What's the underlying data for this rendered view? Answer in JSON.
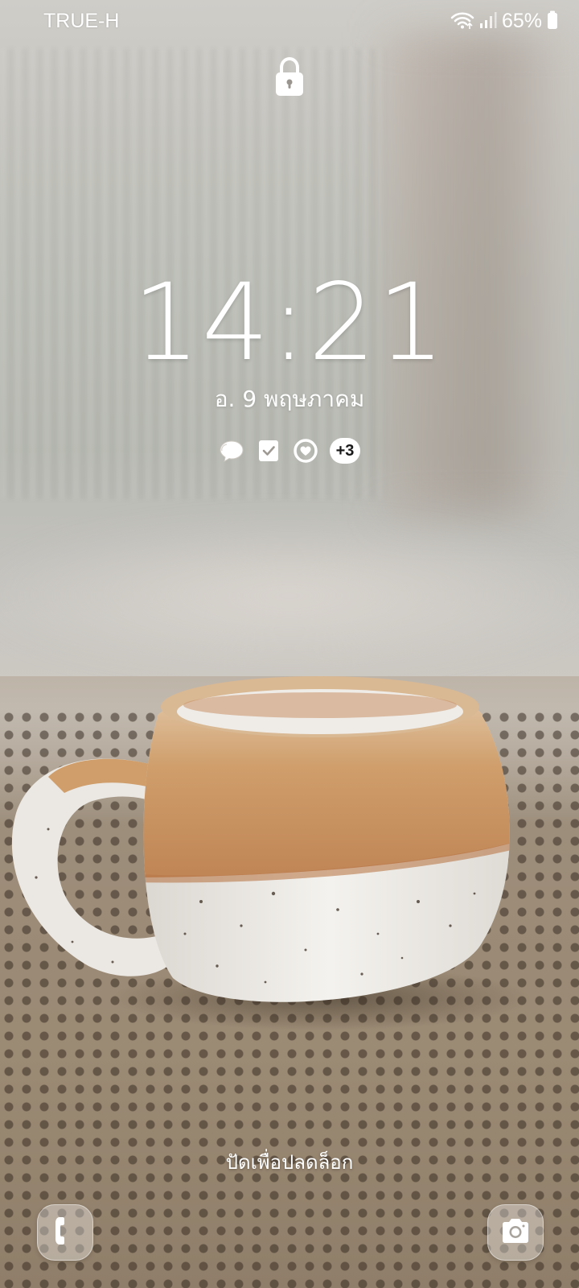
{
  "status_bar": {
    "carrier": "TRUE-H",
    "wifi_icon": "wifi-icon",
    "signal_icon": "cellular-signal-icon",
    "battery_percent": "65%",
    "battery_icon": "battery-icon"
  },
  "lock_icon": "padlock-icon",
  "clock": {
    "hours": "14",
    "separator": ":",
    "minutes": "21"
  },
  "date": "อ. 9 พฤษภาคม",
  "notifications": {
    "icons": [
      "chat-bubble-icon",
      "checklist-icon",
      "heart-circle-icon"
    ],
    "more_count": "+3"
  },
  "unlock_hint": "ปัดเพื่อปลดล็อก",
  "shortcuts": {
    "left": "phone-icon",
    "right": "camera-icon"
  },
  "colors": {
    "text": "#ffffff",
    "badge_bg": "#ffffff",
    "badge_text": "#1a1a1a"
  }
}
